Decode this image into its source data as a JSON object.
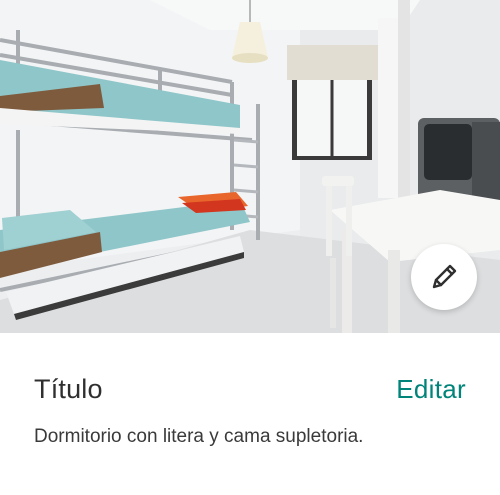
{
  "photo": {
    "subject": "bedroom-photo"
  },
  "edit_fab": {
    "icon": "pencil-icon"
  },
  "listing": {
    "title_label": "Título",
    "edit_label": "Editar",
    "description": "Dormitorio con litera y cama supletoria."
  },
  "colors": {
    "accent": "#00847a",
    "text": "#2f2f2f"
  }
}
